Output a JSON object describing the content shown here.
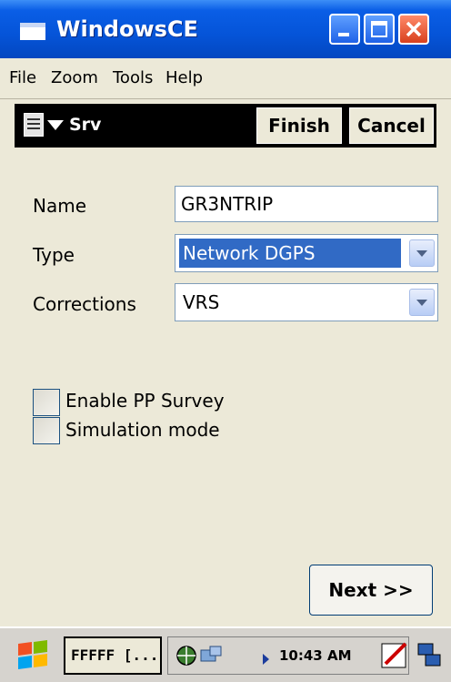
{
  "window": {
    "title": "WindowsCE"
  },
  "menu": [
    "File",
    "Zoom",
    "Tools",
    "Help"
  ],
  "toolbar": {
    "title": "Srv",
    "finish_label": "Finish",
    "cancel_label": "Cancel"
  },
  "form": {
    "name_label": "Name",
    "name_value": "GR3NTRIP",
    "type_label": "Type",
    "type_value": "Network DGPS",
    "corrections_label": "Corrections",
    "corrections_value": "VRS"
  },
  "checkboxes": [
    {
      "label": "Enable PP Survey",
      "checked": false
    },
    {
      "label": "Simulation mode",
      "checked": false
    }
  ],
  "next_label": "Next >>",
  "taskbar": {
    "task_label": "FFFFF [...",
    "clock": "10:43 AM"
  },
  "colors": {
    "titlebar": "#0554d8",
    "selection": "#316ac5",
    "window_bg": "#ece9d8"
  }
}
